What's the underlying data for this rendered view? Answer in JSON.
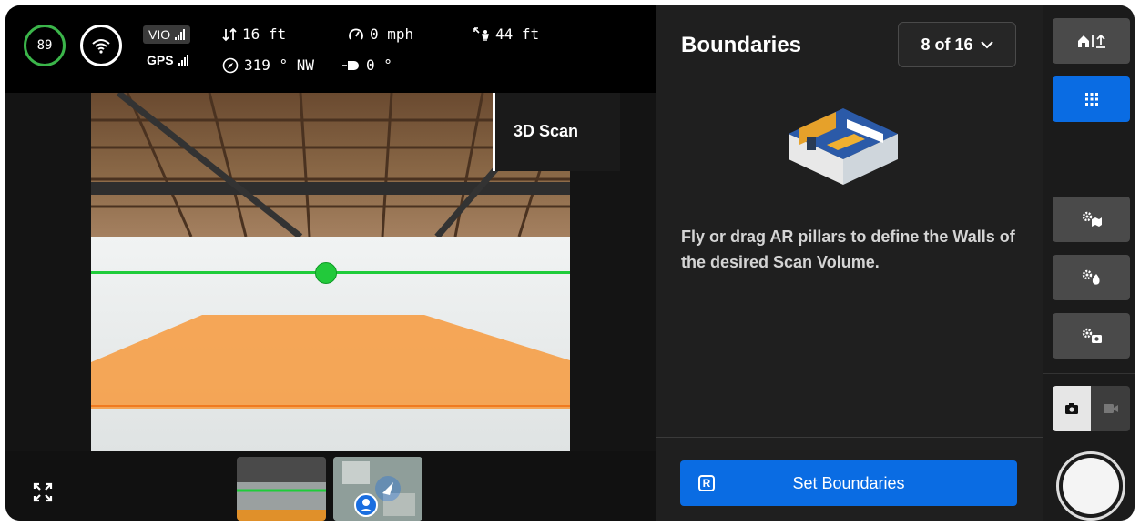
{
  "status": {
    "battery": "89",
    "vio_label": "VIO",
    "gps_label": "GPS",
    "altitude": "16 ft",
    "speed": "0 mph",
    "distance": "44 ft",
    "heading": "319 ° NW",
    "gimbal": "0 °"
  },
  "viewport": {
    "scan_label": "3D Scan"
  },
  "panel": {
    "title": "Boundaries",
    "step": "8 of 16",
    "instruction": "Fly or drag AR pillars to define the Walls of the desired Scan Volume.",
    "primary_button": "Set Boundaries",
    "key_hint": "R"
  },
  "colors": {
    "accent": "#0a6ce3",
    "battery_ring": "#3bb54a",
    "boundary_line": "#1fcc3a",
    "floor_fill": "#f5a04a"
  },
  "icons": {
    "wifi": "wifi-icon",
    "altitude": "altitude-icon",
    "speed": "speedometer-icon",
    "distance": "home-distance-icon",
    "heading": "compass-icon",
    "gimbal": "camera-tilt-icon",
    "expand": "expand-icon",
    "home_return": "home-return-icon",
    "grid": "grid-icon",
    "settings_map": "settings-map-icon",
    "settings_obstacle": "settings-obstacle-icon",
    "settings_camera": "settings-camera-icon",
    "photo": "camera-icon",
    "video": "video-icon",
    "shutter": "shutter-button"
  }
}
